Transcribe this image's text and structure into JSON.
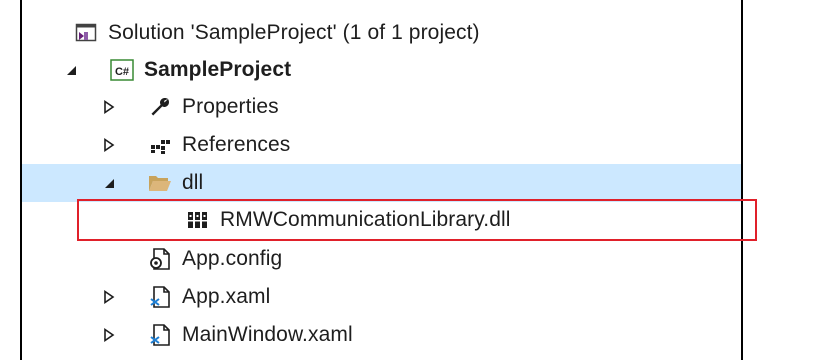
{
  "tree": {
    "solution": {
      "label": "Solution 'SampleProject' (1 of 1 project)",
      "icon": "solution-icon"
    },
    "project": {
      "label": "SampleProject",
      "icon": "csharp-project-icon",
      "badge": "C#",
      "expanded": true
    },
    "items": [
      {
        "label": "Properties",
        "icon": "wrench-icon",
        "expandable": true,
        "expanded": false
      },
      {
        "label": "References",
        "icon": "references-icon",
        "expandable": true,
        "expanded": false
      },
      {
        "label": "dll",
        "icon": "folder-open-icon",
        "expandable": true,
        "expanded": true,
        "selected": true
      },
      {
        "label": "RMWCommunicationLibrary.dll",
        "icon": "library-icon",
        "expandable": false,
        "highlighted": true
      },
      {
        "label": "App.config",
        "icon": "config-file-icon",
        "expandable": false
      },
      {
        "label": "App.xaml",
        "icon": "xaml-file-icon",
        "expandable": true,
        "expanded": false
      },
      {
        "label": "MainWindow.xaml",
        "icon": "xaml-file-icon",
        "expandable": true,
        "expanded": false
      }
    ]
  },
  "colors": {
    "selection": "#cce8ff",
    "highlight_border": "#e0202a",
    "solution_purple": "#68217a",
    "csharp_green": "#388a34",
    "folder_yellow": "#dcb67a",
    "xaml_blue": "#1e7fd4"
  }
}
